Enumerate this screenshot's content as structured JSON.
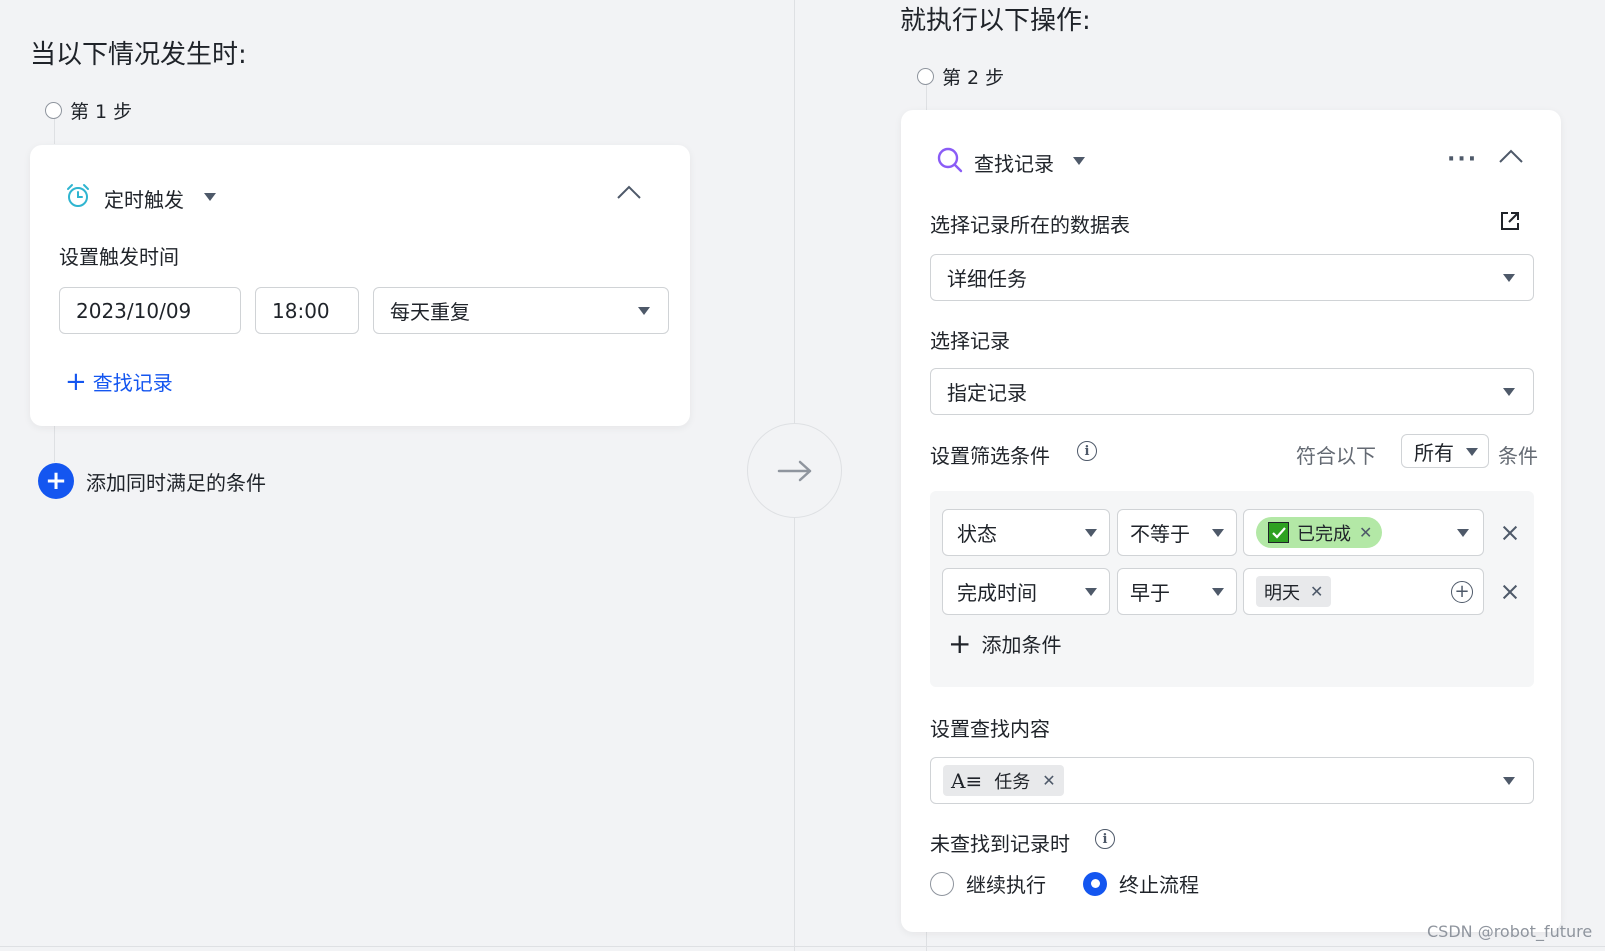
{
  "left": {
    "heading": "当以下情况发生时:",
    "step_label": "第 1 步",
    "trigger": {
      "name": "定时触发",
      "icon": "alarm-clock-icon",
      "section_label": "设置触发时间",
      "date": "2023/10/09",
      "time": "18:00",
      "repeat": "每天重复",
      "add_action": "查找记录"
    },
    "add_condition": "添加同时满足的条件"
  },
  "right": {
    "heading": "就执行以下操作:",
    "step_label": "第 2 步",
    "action": {
      "name": "查找记录",
      "icon": "search-icon",
      "table_label": "选择记录所在的数据表",
      "table_value": "详细任务",
      "record_label": "选择记录",
      "record_value": "指定记录",
      "filter_label": "设置筛选条件",
      "match_prefix": "符合以下",
      "match_mode": "所有",
      "match_suffix": "条件",
      "filters": [
        {
          "field": "状态",
          "operator": "不等于",
          "value": "已完成"
        },
        {
          "field": "完成时间",
          "operator": "早于",
          "value": "明天"
        }
      ],
      "add_filter": "添加条件",
      "content_label": "设置查找内容",
      "content_tag": "任务",
      "not_found_label": "未查找到记录时",
      "options": [
        "继续执行",
        "终止流程"
      ],
      "selected_option": "终止流程"
    }
  },
  "watermark": "CSDN @robot_future",
  "colors": {
    "accent": "#1456f0",
    "trigger_icon": "#2fb5d0",
    "search_icon": "#8a5cf6",
    "done_tag_bg": "#b3e8a6",
    "done_check_bg": "#2ea121"
  }
}
